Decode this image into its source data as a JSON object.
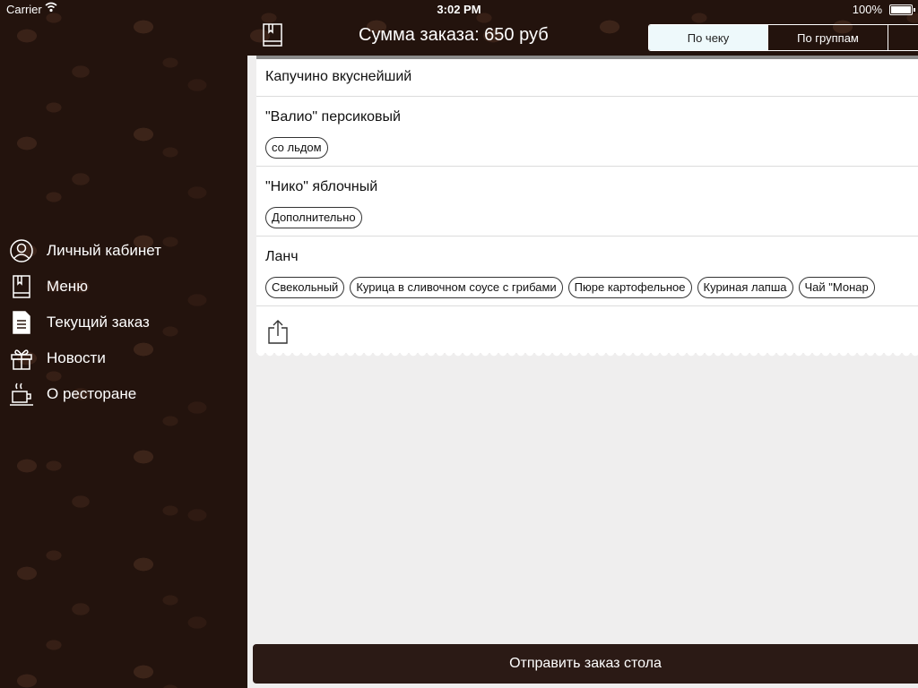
{
  "status_bar": {
    "carrier": "Carrier",
    "time": "3:02 PM",
    "battery": "100%"
  },
  "sidebar": {
    "items": [
      {
        "label": "Личный кабинет",
        "icon": "user-icon"
      },
      {
        "label": "Меню",
        "icon": "book-icon"
      },
      {
        "label": "Текущий заказ",
        "icon": "document-icon"
      },
      {
        "label": "Новости",
        "icon": "gift-icon"
      },
      {
        "label": "О ресторане",
        "icon": "coffee-cup-icon"
      }
    ]
  },
  "header": {
    "title": "Сумма заказа: 650 руб",
    "tabs": [
      "По чеку",
      "По группам"
    ]
  },
  "order": {
    "items": [
      {
        "name": "Капучино вкуснейший",
        "tags": []
      },
      {
        "name": "\"Валио\" персиковый",
        "tags": [
          "со льдом"
        ]
      },
      {
        "name": "\"Нико\" яблочный",
        "tags": [
          "Дополнительно"
        ]
      },
      {
        "name": "Ланч",
        "tags": [
          "Свекольный",
          "Курица в сливочном соусе с грибами",
          "Пюре картофельное",
          "Куриная лапша",
          "Чай \"Монар"
        ]
      }
    ]
  },
  "footer": {
    "send_label": "Отправить заказ стола"
  }
}
